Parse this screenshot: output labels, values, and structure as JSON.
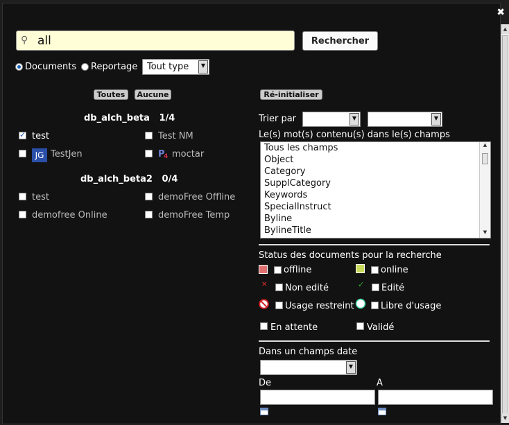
{
  "search": {
    "value": "all",
    "button_label": "Rechercher"
  },
  "scope": {
    "options": [
      {
        "label": "Documents",
        "selected": true
      },
      {
        "label": "Reportage",
        "selected": false
      }
    ],
    "type_select": "Tout type"
  },
  "left": {
    "buttons": {
      "all": "Toutes",
      "none": "Aucune"
    },
    "databases": [
      {
        "name": "db_alch_beta",
        "count": "1/4",
        "items": [
          {
            "label": "test",
            "checked": true,
            "icon": null
          },
          {
            "label": "Test NM",
            "checked": false,
            "icon": null
          },
          {
            "label": "TestJen",
            "checked": false,
            "icon": "avatar-jg",
            "icon_text": "JG"
          },
          {
            "label": "moctar",
            "checked": false,
            "icon": "avatar-p",
            "icon_text": "P"
          }
        ]
      },
      {
        "name": "db_alch_beta2",
        "count": "0/4",
        "items": [
          {
            "label": "test",
            "checked": false
          },
          {
            "label": "demoFree Offline",
            "checked": false
          },
          {
            "label": "demofree Online",
            "checked": false
          },
          {
            "label": "demoFree Temp",
            "checked": false
          }
        ]
      }
    ]
  },
  "right": {
    "reset_label": "Ré-initialiser",
    "sort_label": "Trier par",
    "fields_label": "Le(s) mot(s) contenu(s) dans le(s) champs",
    "fields": [
      "Tous les champs",
      "Object",
      "Category",
      "SupplCategory",
      "Keywords",
      "SpecialInstruct",
      "Byline",
      "BylineTitle"
    ],
    "status_title": "Status des documents pour la recherche",
    "status": [
      {
        "label": "offline",
        "icon": "offline-square-icon",
        "color": "#e07070"
      },
      {
        "label": "online",
        "icon": "online-square-icon",
        "color": "#c8d85a"
      },
      {
        "label": "Non edité",
        "icon": "cross-icon",
        "color": "#e03030"
      },
      {
        "label": "Edité",
        "icon": "check-icon",
        "color": "#30b030"
      },
      {
        "label": "Usage restreint",
        "icon": "no-entry-icon",
        "color": "#d02020"
      },
      {
        "label": "Libre d'usage",
        "icon": "circle-icon",
        "color": "#ffffff"
      },
      {
        "label": "En attente",
        "icon": null
      },
      {
        "label": "Validé",
        "icon": null
      }
    ],
    "date_title": "Dans un champs date",
    "from_label": "De",
    "to_label": "A"
  }
}
